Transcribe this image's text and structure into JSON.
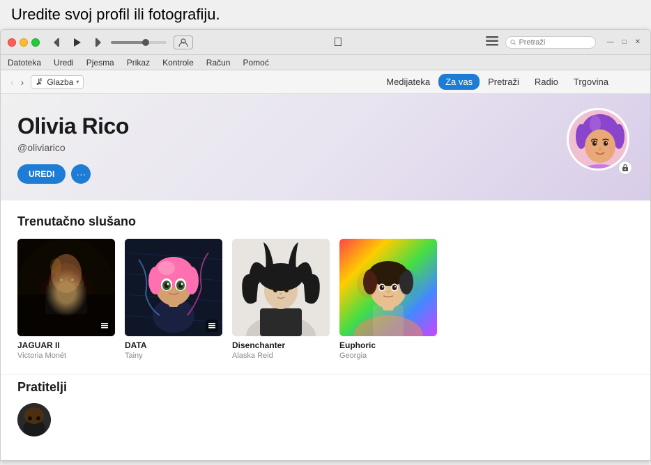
{
  "instruction": {
    "text": "Uredite svoj profil ili fotografiju."
  },
  "titlebar": {
    "playback": {
      "back": "⏮",
      "play": "▶",
      "forward": "⏭"
    },
    "apple_logo": "",
    "search_placeholder": "Pretraži",
    "window_controls": {
      "minimize": "—",
      "maximize": "□",
      "close": "✕"
    }
  },
  "menubar": {
    "items": [
      "Datoteka",
      "Uredi",
      "Pjesma",
      "Prikaz",
      "Kontrole",
      "Račun",
      "Pomoć"
    ]
  },
  "navbar": {
    "library_label": "Glazba",
    "tabs": [
      {
        "label": "Medijateka",
        "active": false
      },
      {
        "label": "Za vas",
        "active": true
      },
      {
        "label": "Pretraži",
        "active": false
      },
      {
        "label": "Radio",
        "active": false
      },
      {
        "label": "Trgovina",
        "active": false
      }
    ]
  },
  "profile": {
    "name": "Olivia Rico",
    "handle": "@oliviarico",
    "edit_button": "UREDI",
    "more_button": "···",
    "avatar_emoji": "🧕"
  },
  "currently_listening": {
    "section_title": "Trenutačno slušano",
    "albums": [
      {
        "title": "JAGUAR II",
        "artist": "Victoria Monét",
        "has_list_icon": true,
        "art_class": "album-jaguar"
      },
      {
        "title": "DATA",
        "artist": "Tainy",
        "has_list_icon": true,
        "art_class": "album-data"
      },
      {
        "title": "Disenchanter",
        "artist": "Alaska Reid",
        "has_list_icon": false,
        "art_class": "album-disenchanter"
      },
      {
        "title": "Euphoric",
        "artist": "Georgia",
        "has_list_icon": false,
        "art_class": "album-euphoric"
      }
    ]
  },
  "friends": {
    "section_title": "Pratitelji"
  }
}
